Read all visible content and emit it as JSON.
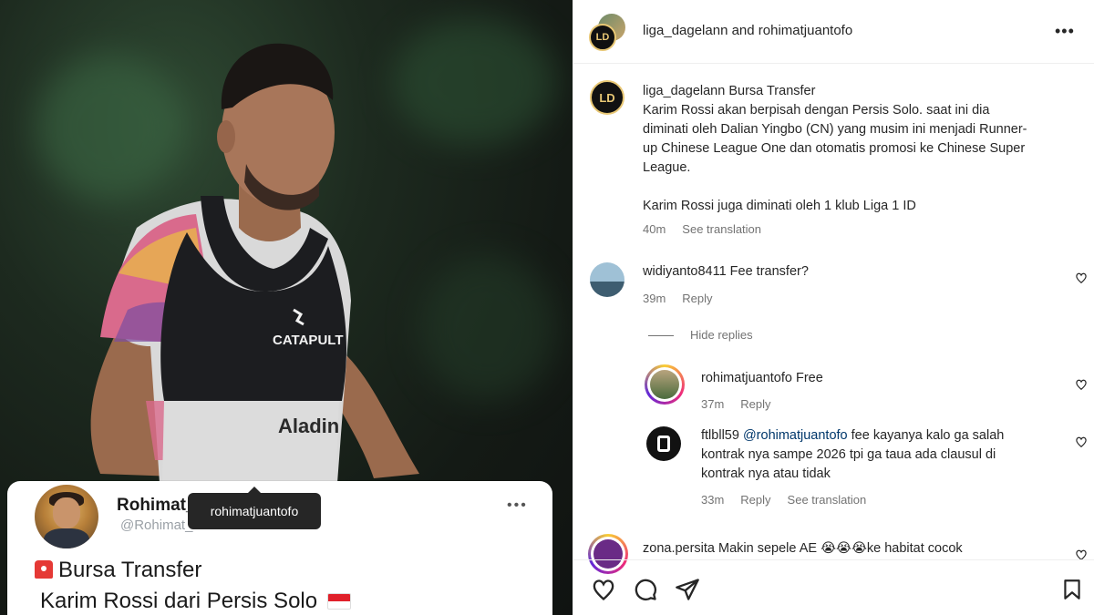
{
  "post_card": {
    "author_name": "Rohimat_Juantofo",
    "author_handle": "@Rohimat_Juantofo",
    "more": "•••",
    "line1": "Bursa Transfer",
    "line2": "Karim Rossi dari Persis Solo"
  },
  "shirt": {
    "brand": "CATAPULT",
    "sponsor": "Aladin"
  },
  "tooltip": "rohimatjuantofo",
  "header": {
    "avatar_logo": "LD",
    "title": "liga_dagelann and rohimatjuantofo",
    "more": "•••"
  },
  "caption": {
    "username": "liga_dagelann",
    "text_intro": "Bursa Transfer",
    "para1_lines": [
      "Karim Rossi akan berpisah dengan Persis Solo. saat ini dia",
      "diminati oleh Dalian Yingbo (CN) yang musim ini menjadi Runner-",
      "up Chinese League One dan otomatis promosi ke Chinese Super",
      "League."
    ],
    "para2": "Karim Rossi juga diminati oleh 1 klub Liga 1 ID",
    "time": "40m",
    "translate": "See translation"
  },
  "comments": [
    {
      "user": "widiyanto8411",
      "text": "Fee transfer?",
      "time": "39m",
      "reply": "Reply"
    },
    {
      "user": "rohimatjuantofo",
      "text": "Free",
      "time": "37m",
      "reply": "Reply"
    },
    {
      "user": "ftlbll59",
      "mention": "@rohimatjuantofo",
      "lines": [
        "fee kayanya kalo ga salah",
        "kontrak nya sampe 2026 tpi ga taua ada clausul di",
        "kontrak nya atau tidak"
      ],
      "time": "33m",
      "reply": "Reply",
      "translate": "See translation"
    },
    {
      "user": "zona.persita",
      "text": "Makin sepele AE 😭😭😭ke habitat cocok"
    }
  ],
  "hide_replies": "Hide replies",
  "colors": {
    "accent_link": "#00376b",
    "muted": "#737373",
    "text": "#262626"
  }
}
